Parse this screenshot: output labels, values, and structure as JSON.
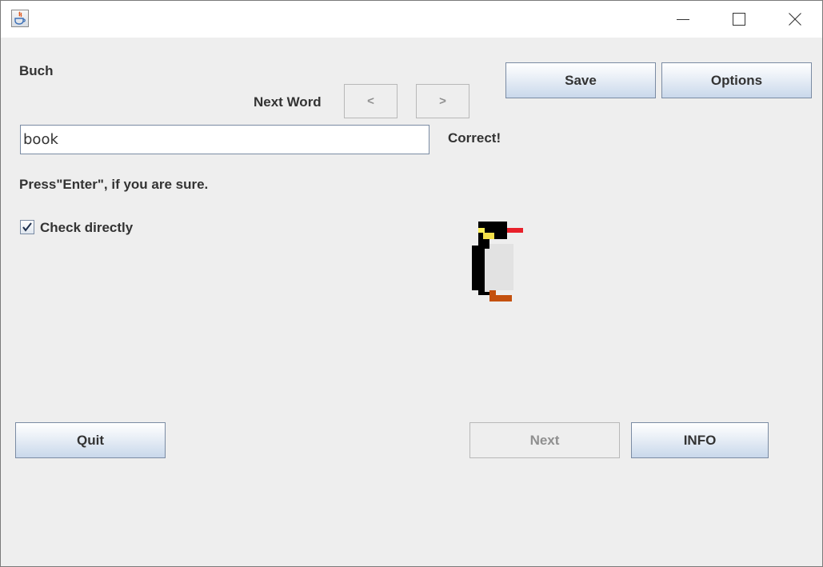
{
  "window": {
    "app_icon": "java-coffee-cup-icon",
    "controls": [
      "minimize-icon",
      "maximize-icon",
      "close-icon"
    ]
  },
  "word_label": "Buch",
  "next_word": {
    "label": "Next Word",
    "prev_label": "<",
    "next_label": ">"
  },
  "toolbar": {
    "save_label": "Save",
    "options_label": "Options"
  },
  "answer": {
    "value": "book",
    "feedback": "Correct!"
  },
  "hint": "Press\"Enter\", if you are sure.",
  "check_directly": {
    "label": "Check directly",
    "checked": true
  },
  "mascot": "penguin-image",
  "footer": {
    "quit_label": "Quit",
    "next_label": "Next",
    "info_label": "INFO"
  },
  "colors": {
    "background": "#eeeeee",
    "button_gradient_top": "#ffffff",
    "button_gradient_bottom": "#c9d8eb",
    "button_border": "#7a8ba3",
    "text": "#333333",
    "disabled_text": "#8f8f8f"
  }
}
